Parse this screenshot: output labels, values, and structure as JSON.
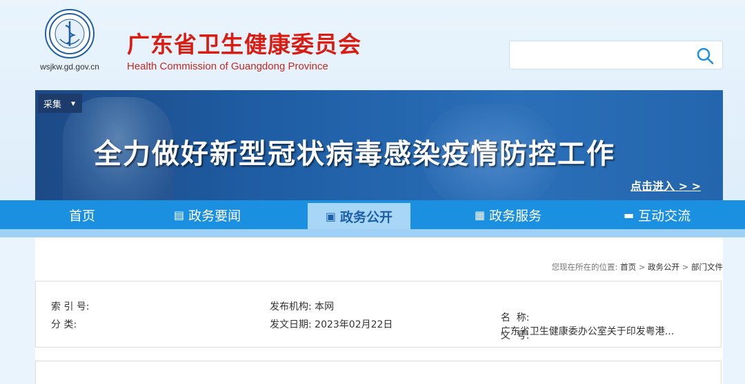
{
  "header": {
    "domain": "wsjkw.gd.gov.cn",
    "title_cn": "广东省卫生健康委员会",
    "title_en": "Health Commission of Guangdong Province",
    "search_placeholder": ""
  },
  "banner": {
    "tag": "采集",
    "headline": "全力做好新型冠状病毒感染疫情防控工作",
    "link": "点击进入 > >"
  },
  "nav": {
    "items": [
      {
        "label": "首页",
        "icon": ""
      },
      {
        "label": "政务要闻",
        "icon": "news-icon"
      },
      {
        "label": "政务公开",
        "icon": "document-icon"
      },
      {
        "label": "政务服务",
        "icon": "clipboard-icon"
      },
      {
        "label": "互动交流",
        "icon": "chat-icon"
      }
    ],
    "active": "政务公开"
  },
  "breadcrumb": {
    "prefix": "您现在所在的位置:",
    "items": [
      "首页",
      "政务公开",
      "部门文件"
    ],
    "separator": ">"
  },
  "info": {
    "index_label": "索 引 号:",
    "index_value": "",
    "category_label": "分 类:",
    "category_value": "",
    "publisher_label": "发布机构:",
    "publisher_value": "本网",
    "date_label": "发文日期:",
    "date_value": "2023年02月22日",
    "name_label": "名  称:",
    "name_value": "广东省卫生健康委办公室关于印发粤港...",
    "docno_label": "文  号:",
    "docno_value": ""
  },
  "colors": {
    "brand_red": "#d91d12",
    "nav_blue": "#1b8fe0",
    "nav_active_bg": "#a8d6f7"
  }
}
